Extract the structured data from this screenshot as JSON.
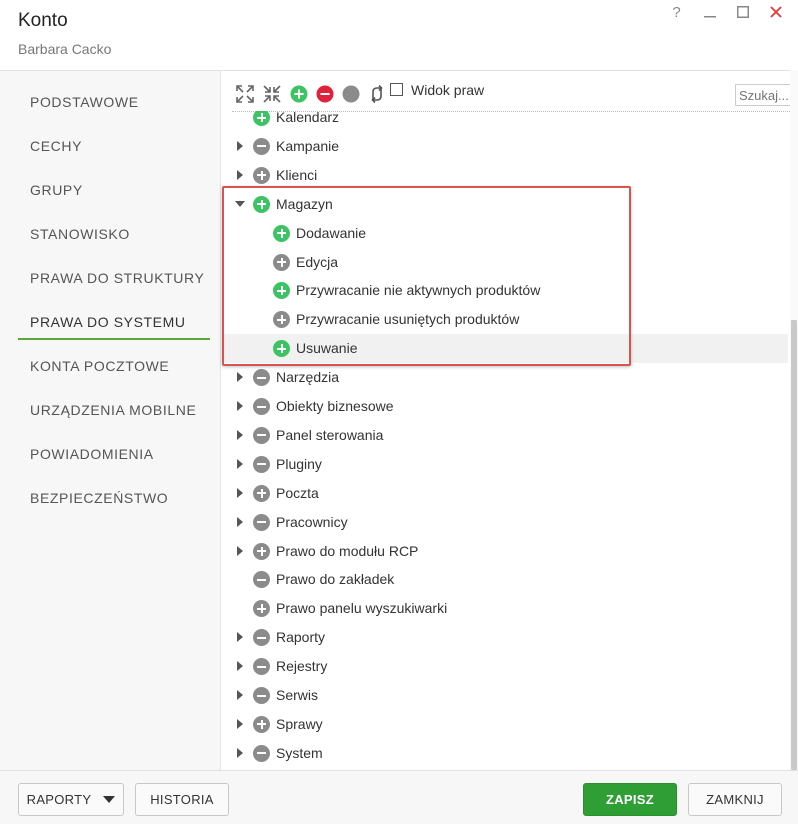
{
  "window": {
    "title": "Konto",
    "subtitle": "Barbara Cacko",
    "help": "?"
  },
  "sidebar": {
    "items": [
      {
        "label": "PODSTAWOWE",
        "active": false
      },
      {
        "label": "CECHY",
        "active": false
      },
      {
        "label": "GRUPY",
        "active": false
      },
      {
        "label": "STANOWISKO",
        "active": false
      },
      {
        "label": "PRAWA DO STRUKTURY",
        "active": false
      },
      {
        "label": "PRAWA DO SYSTEMU",
        "active": true
      },
      {
        "label": "KONTA POCZTOWE",
        "active": false
      },
      {
        "label": "URZĄDZENIA MOBILNE",
        "active": false
      },
      {
        "label": "POWIADOMIENIA",
        "active": false
      },
      {
        "label": "BEZPIECZEŃSTWO",
        "active": false
      }
    ]
  },
  "toolbar": {
    "expand_icon": "expand-all-icon",
    "collapse_icon": "collapse-all-icon",
    "grant_icon": "grant-all-icon",
    "revoke_icon": "revoke-all-icon",
    "neutral_icon": "neutral-icon",
    "refresh_icon": "refresh-icon",
    "view_label": "Widok praw",
    "search_placeholder": "Szukaj..."
  },
  "tree": {
    "rows": [
      {
        "label": "Kalendarz",
        "icon": "add",
        "caret": "none",
        "level": 0
      },
      {
        "label": "Kampanie",
        "icon": "sub",
        "caret": "right",
        "level": 0
      },
      {
        "label": "Klienci",
        "icon": "grey-add",
        "caret": "right",
        "level": 0
      },
      {
        "label": "Magazyn",
        "icon": "add",
        "caret": "down",
        "level": 0
      },
      {
        "label": "Dodawanie",
        "icon": "add",
        "caret": "none",
        "level": 1
      },
      {
        "label": "Edycja",
        "icon": "grey-add",
        "caret": "none",
        "level": 1
      },
      {
        "label": "Przywracanie nie aktywnych produktów",
        "icon": "add",
        "caret": "none",
        "level": 1
      },
      {
        "label": "Przywracanie usuniętych produktów",
        "icon": "grey-add",
        "caret": "none",
        "level": 1
      },
      {
        "label": "Usuwanie",
        "icon": "add",
        "caret": "none",
        "level": 1,
        "selected": true
      },
      {
        "label": "Narzędzia",
        "icon": "sub",
        "caret": "right",
        "level": 0
      },
      {
        "label": "Obiekty biznesowe",
        "icon": "sub",
        "caret": "right",
        "level": 0
      },
      {
        "label": "Panel sterowania",
        "icon": "sub",
        "caret": "right",
        "level": 0
      },
      {
        "label": "Pluginy",
        "icon": "sub",
        "caret": "right",
        "level": 0
      },
      {
        "label": "Poczta",
        "icon": "grey-add",
        "caret": "right",
        "level": 0
      },
      {
        "label": "Pracownicy",
        "icon": "sub",
        "caret": "right",
        "level": 0
      },
      {
        "label": "Prawo do modułu RCP",
        "icon": "grey-add",
        "caret": "right",
        "level": 0
      },
      {
        "label": "Prawo do zakładek",
        "icon": "sub",
        "caret": "none",
        "level": 0
      },
      {
        "label": "Prawo panelu wyszukiwarki",
        "icon": "grey-add",
        "caret": "none",
        "level": 0
      },
      {
        "label": "Raporty",
        "icon": "sub",
        "caret": "right",
        "level": 0
      },
      {
        "label": "Rejestry",
        "icon": "sub",
        "caret": "right",
        "level": 0
      },
      {
        "label": "Serwis",
        "icon": "sub",
        "caret": "right",
        "level": 0
      },
      {
        "label": "Sprawy",
        "icon": "grey-add",
        "caret": "right",
        "level": 0
      },
      {
        "label": "System",
        "icon": "sub",
        "caret": "right",
        "level": 0
      }
    ]
  },
  "footer": {
    "reports_label": "RAPORTY",
    "history_label": "HISTORIA",
    "save_label": "ZAPISZ",
    "close_label": "ZAMKNIJ"
  },
  "colors": {
    "accent_green": "#2e9e35",
    "grant_green": "#3cc364",
    "neutral_grey": "#8b8b8b",
    "revoke_red": "#e0213b",
    "highlight_red": "#d9534f",
    "close_red": "#e53935"
  }
}
